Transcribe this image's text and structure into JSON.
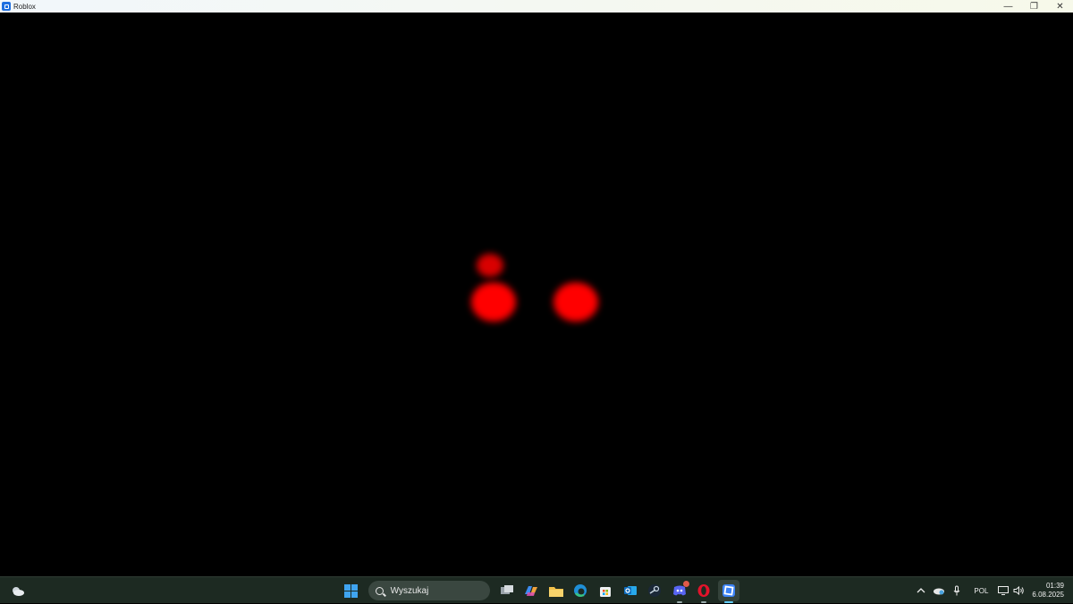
{
  "window": {
    "title": "Roblox",
    "controls": {
      "minimize": "—",
      "restore": "❐",
      "close": "✕"
    }
  },
  "taskbar": {
    "search_placeholder": "Wyszukaj",
    "apps": [
      {
        "name": "task-view",
        "icon": "task-view-icon"
      },
      {
        "name": "copilot",
        "icon": "copilot-icon"
      },
      {
        "name": "file-explorer",
        "icon": "folder-icon"
      },
      {
        "name": "edge",
        "icon": "edge-icon"
      },
      {
        "name": "microsoft-store",
        "icon": "store-icon"
      },
      {
        "name": "outlook",
        "icon": "outlook-icon"
      },
      {
        "name": "steam",
        "icon": "steam-icon"
      },
      {
        "name": "discord",
        "icon": "discord-icon"
      },
      {
        "name": "opera",
        "icon": "opera-icon"
      },
      {
        "name": "roblox",
        "icon": "roblox-icon"
      }
    ],
    "tray": {
      "language": "POL",
      "time": "01:39",
      "date": "6.08.2025"
    }
  },
  "colors": {
    "eyes": "#ff0000",
    "taskbar_bg": "#1d2a22",
    "start_blue": "#3fa4f0",
    "roblox_blue": "#1e6fe0"
  }
}
